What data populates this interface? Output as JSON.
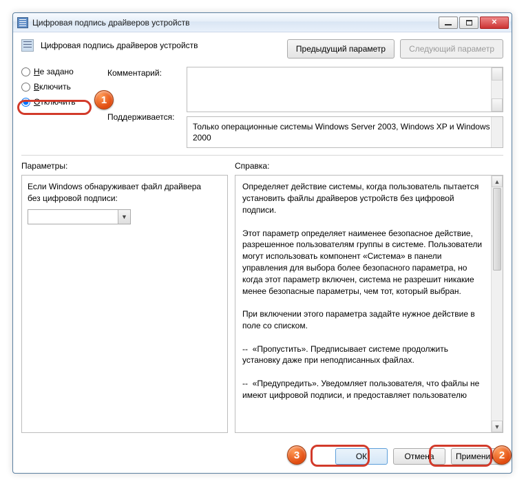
{
  "window": {
    "title": "Цифровая подпись драйверов устройств"
  },
  "header": {
    "title": "Цифровая подпись драйверов устройств",
    "prev_btn": "Предыдущий параметр",
    "next_btn": "Следующий параметр"
  },
  "radios": {
    "not_configured": "Не задано",
    "enabled": "Включить",
    "disabled": "Отключить",
    "selected": "disabled"
  },
  "labels": {
    "comment": "Комментарий:",
    "supported": "Поддерживается:",
    "parameters": "Параметры:",
    "help": "Справка:"
  },
  "comment": "",
  "supported": "Только операционные системы Windows Server 2003, Windows XP и Windows 2000",
  "params_text": "Если Windows обнаруживает файл драйвера без цифровой подписи:",
  "params_combo_value": "",
  "help_text": "Определяет действие системы, когда пользователь пытается установить файлы драйверов устройств без цифровой подписи.\n\nЭтот параметр определяет наименее безопасное действие, разрешенное пользователям группы в системе. Пользователи могут использовать компонент «Система» в панели управления для выбора более безопасного параметра, но когда этот параметр включен, система не разрешит никакие менее безопасные параметры, чем тот, который выбран.\n\nПри включении этого параметра задайте нужное действие в поле со списком.\n\n--  «Пропустить». Предписывает системе продолжить установку даже при неподписанных файлах.\n\n--  «Предупредить». Уведомляет пользователя, что файлы не имеют цифровой подписи, и предоставляет пользователю",
  "footer": {
    "ok": "ОК",
    "cancel": "Отмена",
    "apply": "Применить"
  },
  "steps": {
    "b1": "1",
    "b2": "2",
    "b3": "3"
  }
}
